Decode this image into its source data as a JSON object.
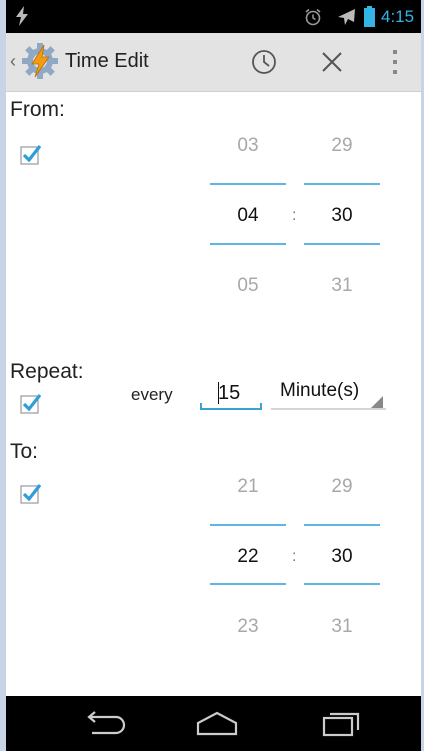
{
  "status_bar": {
    "time": "4:15",
    "icons": [
      "flash-icon",
      "alarm-clock-icon",
      "airplane-icon",
      "battery-icon"
    ],
    "accent_color": "#33b5e5"
  },
  "action_bar": {
    "title": "Time Edit",
    "actions": [
      "clock-icon",
      "close-icon",
      "overflow-menu-icon"
    ]
  },
  "from": {
    "label": "From:",
    "checked": true,
    "hours": {
      "prev": "03",
      "selected": "04",
      "next": "05"
    },
    "minutes": {
      "prev": "29",
      "selected": "30",
      "next": "31"
    },
    "separator": ":"
  },
  "repeat": {
    "label": "Repeat:",
    "checked": true,
    "every_label": "every",
    "value": "15",
    "unit": "Minute(s)"
  },
  "to": {
    "label": "To:",
    "checked": true,
    "hours": {
      "prev": "21",
      "selected": "22",
      "next": "23"
    },
    "minutes": {
      "prev": "29",
      "selected": "30",
      "next": "31"
    },
    "separator": ":"
  },
  "navigation_bar": {
    "buttons": [
      "back-icon",
      "home-icon",
      "recent-apps-icon"
    ]
  }
}
